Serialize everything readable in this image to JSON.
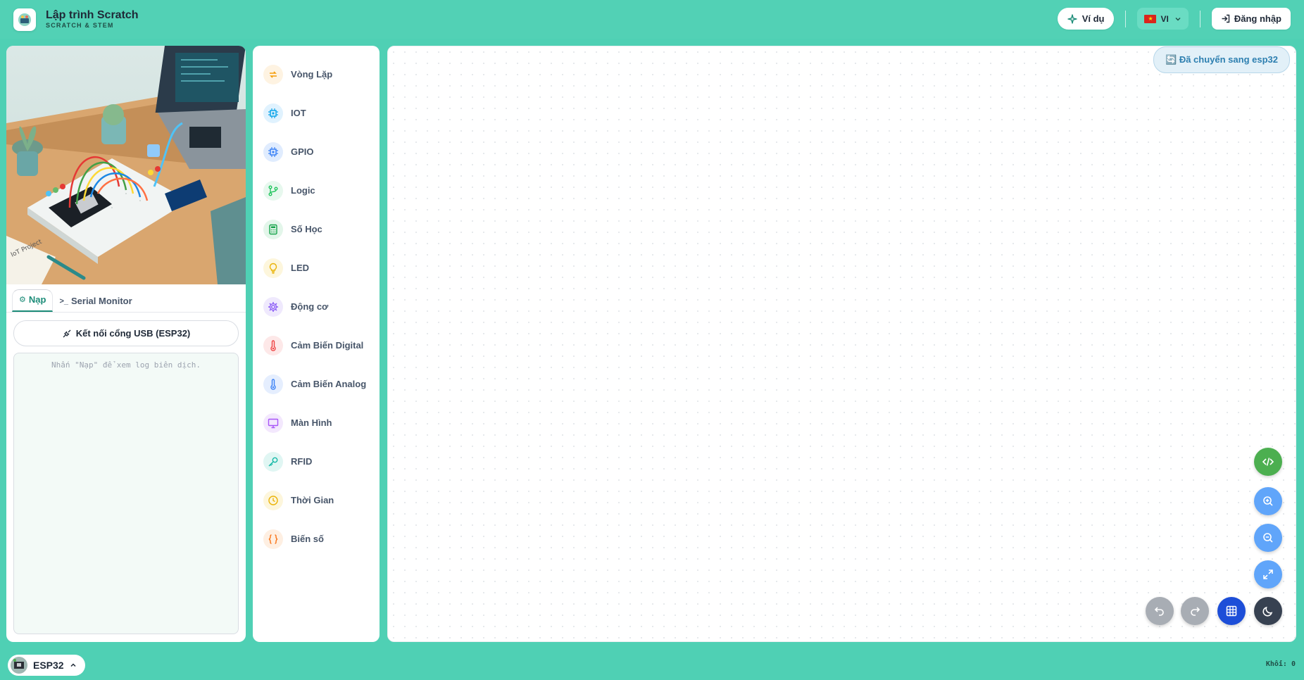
{
  "header": {
    "title": "Lập trình Scratch",
    "subtitle": "SCRATCH & STEM",
    "examples_label": "Ví dụ",
    "language_label": "VI",
    "login_label": "Đăng nhập"
  },
  "left_panel": {
    "tabs": [
      {
        "label": "Nạp",
        "active": true
      },
      {
        "label": "Serial Monitor",
        "active": false
      }
    ],
    "connect_label": "Kết nối cổng USB (ESP32)",
    "log_placeholder": "Nhấn \"Nạp\" để xem log biên dịch."
  },
  "categories": [
    {
      "label": "Vòng Lặp",
      "icon": "loop-icon",
      "color": "#f59e0b",
      "bg": "#fef3e2"
    },
    {
      "label": "IOT",
      "icon": "chip-icon",
      "color": "#0ea5e9",
      "bg": "#e0f2fe"
    },
    {
      "label": "GPIO",
      "icon": "chip-icon",
      "color": "#3b82f6",
      "bg": "#e0ecfe"
    },
    {
      "label": "Logic",
      "icon": "branch-icon",
      "color": "#22c55e",
      "bg": "#e7f8ee"
    },
    {
      "label": "Số Học",
      "icon": "calculator-icon",
      "color": "#16a34a",
      "bg": "#e3f6ea"
    },
    {
      "label": "LED",
      "icon": "bulb-icon",
      "color": "#eab308",
      "bg": "#fdf6dc"
    },
    {
      "label": "Động cơ",
      "icon": "cog-icon",
      "color": "#8b5cf6",
      "bg": "#efe9fd"
    },
    {
      "label": "Cảm Biến Digital",
      "icon": "thermometer-icon",
      "color": "#ef4444",
      "bg": "#fde8e8"
    },
    {
      "label": "Cảm Biến Analog",
      "icon": "thermometer-icon",
      "color": "#3b82f6",
      "bg": "#e5eefe"
    },
    {
      "label": "Màn Hình",
      "icon": "monitor-icon",
      "color": "#a855f7",
      "bg": "#f3e8fd"
    },
    {
      "label": "RFID",
      "icon": "key-icon",
      "color": "#14b8a6",
      "bg": "#e0f6f3"
    },
    {
      "label": "Thời Gian",
      "icon": "clock-icon",
      "color": "#eab308",
      "bg": "#fdf6dc"
    },
    {
      "label": "Biến số",
      "icon": "braces-icon",
      "color": "#f97316",
      "bg": "#feefe2"
    }
  ],
  "workspace": {
    "switched_label": "🔄 Đã chuyển sang esp32"
  },
  "footer": {
    "device_label": "ESP32",
    "block_count_label": "Khối: 0"
  },
  "colors": {
    "accent": "#52d1b5",
    "code_button": "#4caf50",
    "zoom_buttons": "#60a5fa",
    "grid_button": "#1d4ed8",
    "theme_button": "#374151",
    "undo_redo": "#a8adb4"
  }
}
